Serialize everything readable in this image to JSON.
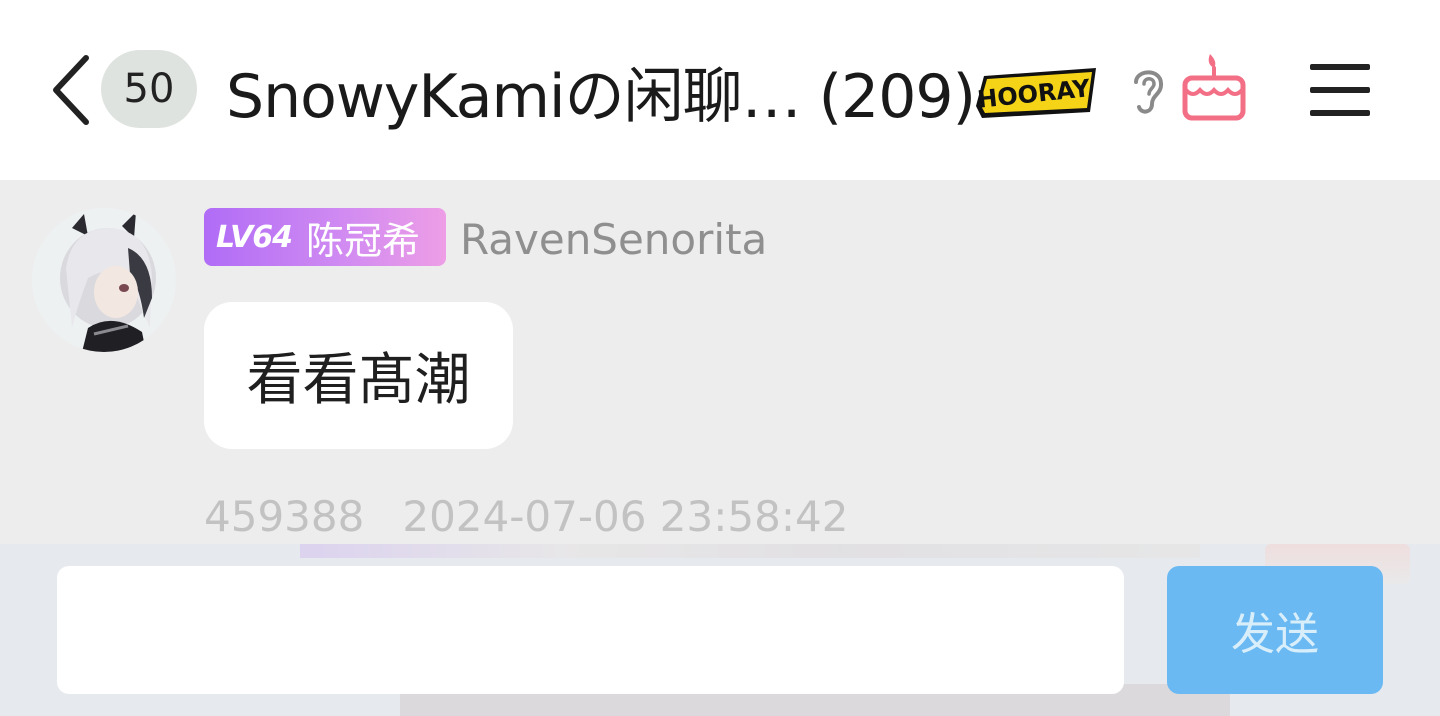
{
  "header": {
    "back_icon": "chevron-left-icon",
    "unread_count": "50",
    "title": "SnowyKamiの闲聊… (209)",
    "badge_image": "hooray-sticker-icon",
    "listen_icon": "ear-icon",
    "cake_icon": "cake-icon",
    "menu_icon": "hamburger-menu-icon",
    "cake_color": "#f36f86"
  },
  "message": {
    "avatar": "avatar-image",
    "level": "LV64",
    "nickname": "陈冠希",
    "username": "RavenSenorita",
    "text": "看看髙潮",
    "message_id": "459388",
    "timestamp": "2024-07-06 23:58:42"
  },
  "composer": {
    "input_value": "",
    "input_placeholder": "",
    "send_label": "发送",
    "send_color": "#6ab9f2"
  }
}
